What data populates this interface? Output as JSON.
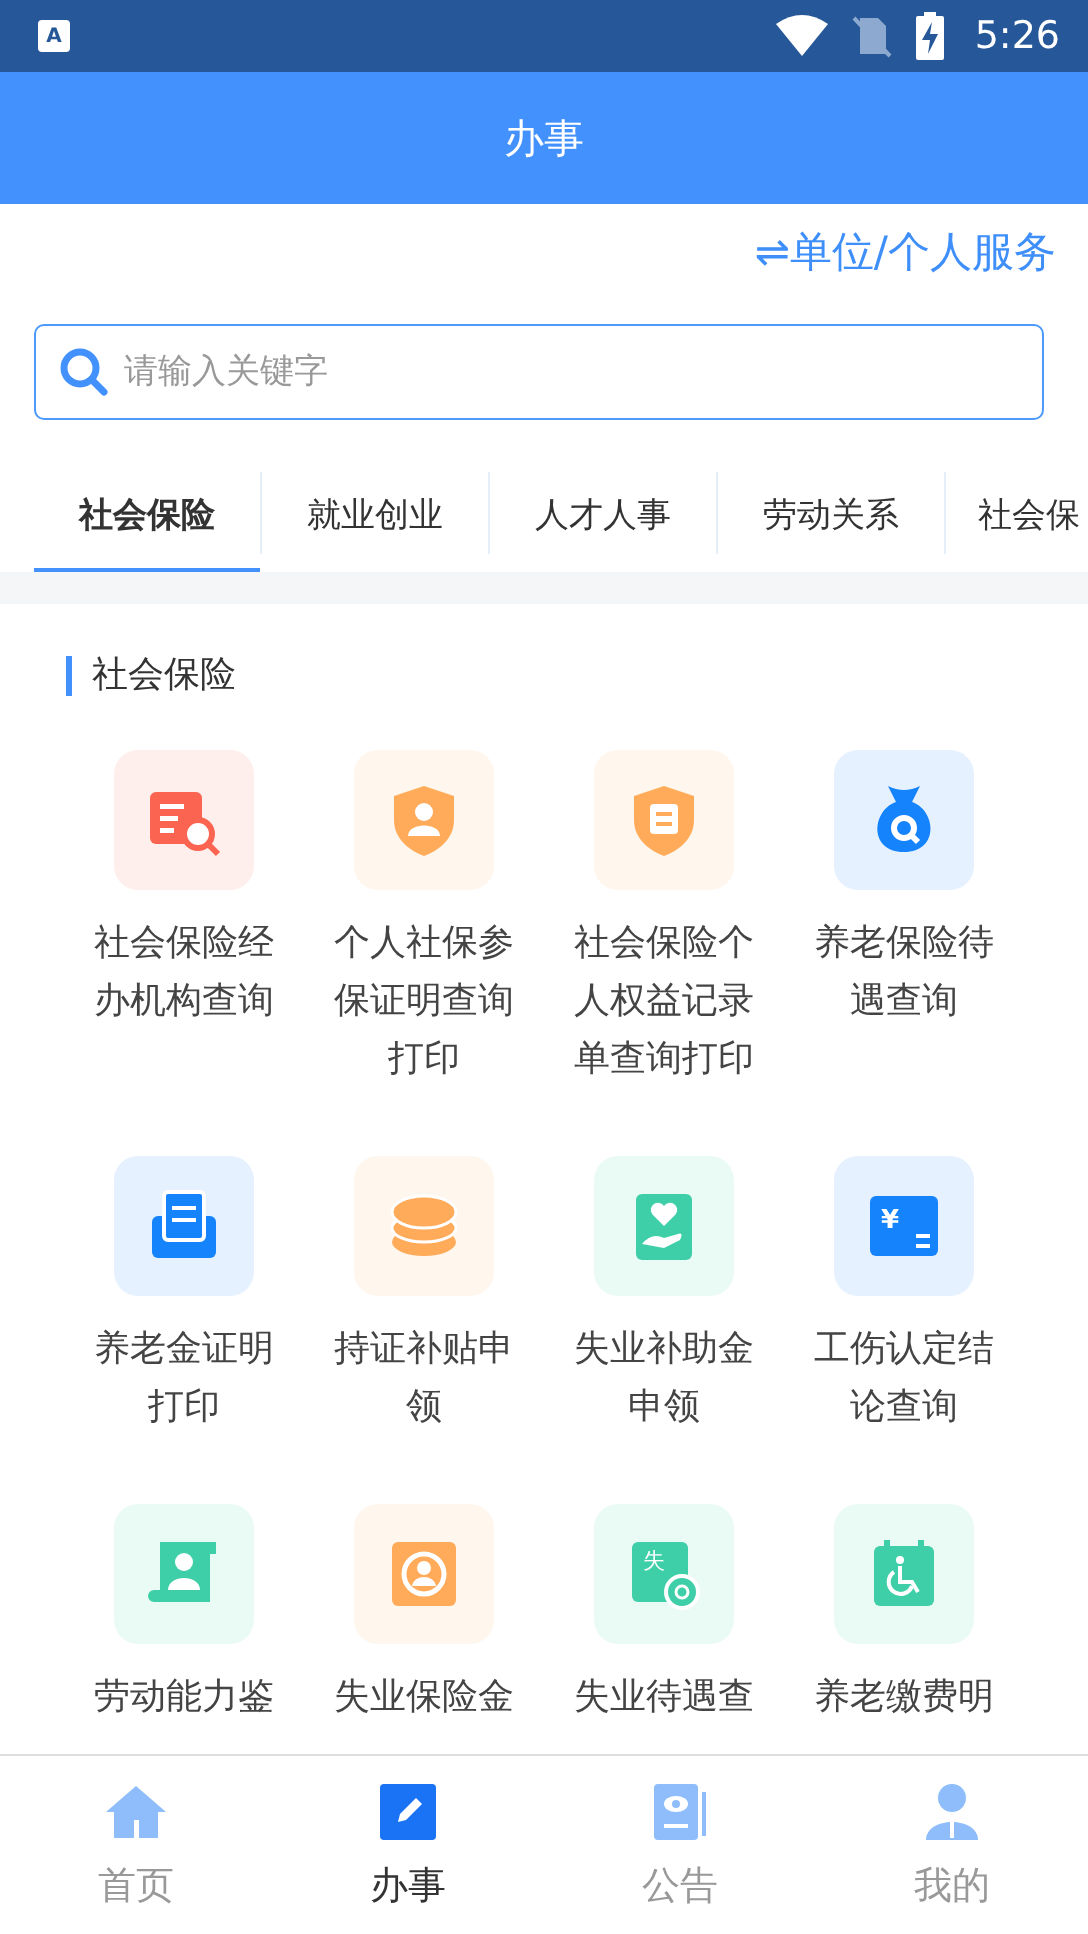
{
  "status_bar": {
    "app_icon_text": "A",
    "time": "5:26"
  },
  "header": {
    "title": "办事"
  },
  "switch_link": "⇌单位/个人服务",
  "search": {
    "placeholder": "请输入关键字"
  },
  "tabs": [
    {
      "label": "社会保险",
      "selected": true
    },
    {
      "label": "就业创业",
      "selected": false
    },
    {
      "label": "人才人事",
      "selected": false
    },
    {
      "label": "劳动关系",
      "selected": false
    },
    {
      "label": "社会保",
      "selected": false
    }
  ],
  "section": {
    "title": "社会保险"
  },
  "services": [
    {
      "lines": [
        "社会保险经",
        "办机构查询"
      ],
      "color": "#fa6450"
    },
    {
      "lines": [
        "个人社保参",
        "保证明查询",
        "打印"
      ],
      "color": "#ffab5a"
    },
    {
      "lines": [
        "社会保险个",
        "人权益记录",
        "单查询打印"
      ],
      "color": "#ffab5a"
    },
    {
      "lines": [
        "养老保险待",
        "遇查询"
      ],
      "color": "#1483fc"
    },
    {
      "lines": [
        "养老金证明",
        "打印"
      ],
      "color": "#1483fc"
    },
    {
      "lines": [
        "持证补贴申",
        "领"
      ],
      "color": "#ffab5a"
    },
    {
      "lines": [
        "失业补助金",
        "申领"
      ],
      "color": "#3fcfa8"
    },
    {
      "lines": [
        "工伤认定结",
        "论查询"
      ],
      "color": "#1483fc",
      "icon_text": "¥"
    },
    {
      "lines": [
        "劳动能力鉴"
      ],
      "color": "#3fcfa8"
    },
    {
      "lines": [
        "失业保险金"
      ],
      "color": "#ffab5a"
    },
    {
      "lines": [
        "失业待遇查"
      ],
      "color": "#3fcfa8",
      "icon_text": "失"
    },
    {
      "lines": [
        "养老缴费明"
      ],
      "color": "#3fcfa8"
    }
  ],
  "bottom_nav": [
    {
      "label": "首页",
      "selected": false
    },
    {
      "label": "办事",
      "selected": true
    },
    {
      "label": "公告",
      "selected": false
    },
    {
      "label": "我的",
      "selected": false
    }
  ]
}
